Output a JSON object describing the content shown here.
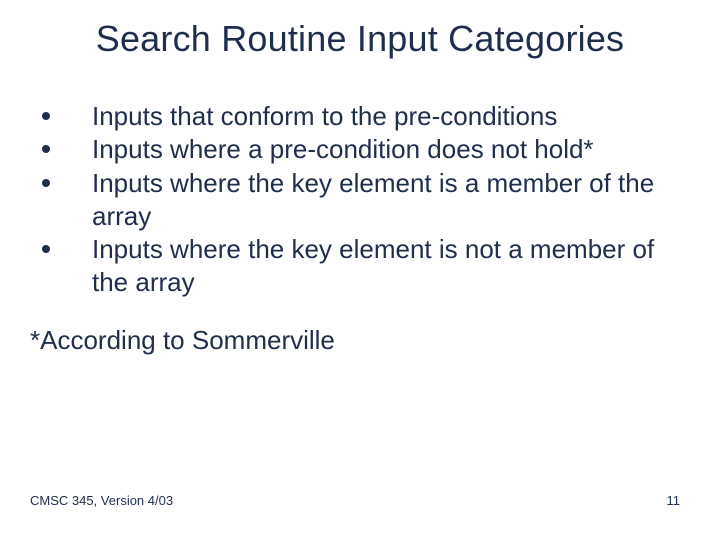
{
  "title": "Search Routine Input Categories",
  "bullets": [
    "Inputs that conform to the pre-conditions",
    "Inputs where a pre-condition does not hold*",
    "Inputs where the key element is a member of the array",
    "Inputs where the key element is not a member of the array"
  ],
  "note": "*According to Sommerville",
  "footer": {
    "left": "CMSC 345, Version 4/03",
    "page": "11"
  }
}
